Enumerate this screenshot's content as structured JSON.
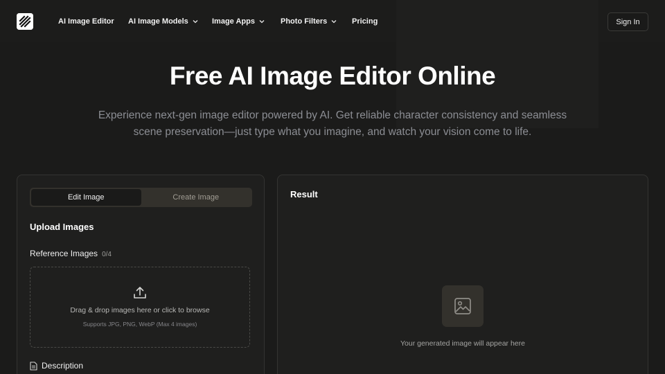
{
  "nav": {
    "items": [
      {
        "label": "AI Image Editor",
        "dropdown": false
      },
      {
        "label": "AI Image Models",
        "dropdown": true
      },
      {
        "label": "Image Apps",
        "dropdown": true
      },
      {
        "label": "Photo Filters",
        "dropdown": true
      },
      {
        "label": "Pricing",
        "dropdown": false
      }
    ],
    "sign_in": "Sign In"
  },
  "hero": {
    "title": "Free AI Image Editor Online",
    "subtitle": "Experience next-gen image editor powered by AI. Get reliable character consistency and seamless scene preservation—just type what you imagine, and watch your vision come to life."
  },
  "editor": {
    "tabs": [
      {
        "label": "Edit Image",
        "active": true
      },
      {
        "label": "Create Image",
        "active": false
      }
    ],
    "upload_title": "Upload Images",
    "reference_label": "Reference Images",
    "reference_count": "0/4",
    "dropzone": {
      "main": "Drag & drop images here or click to browse",
      "sub": "Supports JPG, PNG, WebP (Max 4 images)"
    },
    "description_label": "Description"
  },
  "result": {
    "title": "Result",
    "placeholder": "Your generated image will appear here"
  },
  "colors": {
    "background": "#1b1b1a",
    "panel": "#1f1f1e",
    "panel_border": "#343432",
    "tab_track": "#33312c",
    "muted_text": "#8c8e94"
  },
  "icons": {
    "logo": "diagonal-stripes-logo-icon",
    "dropdown": "chevron-down-icon",
    "upload": "upload-icon",
    "description": "document-icon",
    "placeholder": "image-icon"
  }
}
